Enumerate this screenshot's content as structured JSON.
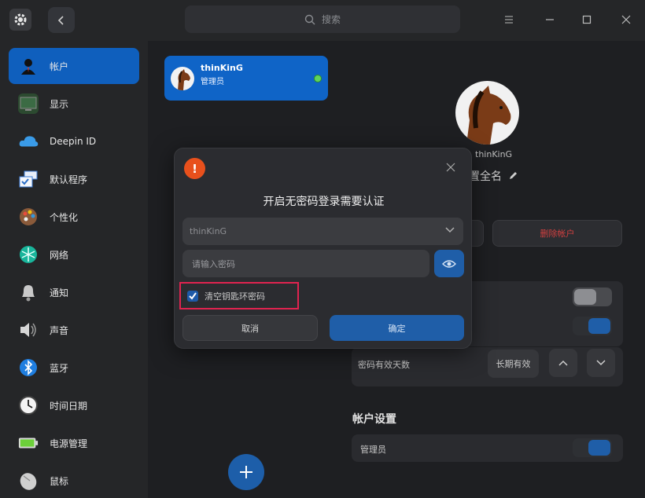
{
  "titlebar": {
    "search_placeholder": "搜索"
  },
  "sidebar": {
    "items": [
      {
        "label": "帐户",
        "icon": "account-icon",
        "active": true
      },
      {
        "label": "显示",
        "icon": "display-icon"
      },
      {
        "label": "Deepin ID",
        "icon": "cloud-icon"
      },
      {
        "label": "默认程序",
        "icon": "default-apps-icon"
      },
      {
        "label": "个性化",
        "icon": "palette-icon"
      },
      {
        "label": "网络",
        "icon": "network-icon"
      },
      {
        "label": "通知",
        "icon": "bell-icon"
      },
      {
        "label": "声音",
        "icon": "speaker-icon"
      },
      {
        "label": "蓝牙",
        "icon": "bluetooth-icon"
      },
      {
        "label": "时间日期",
        "icon": "clock-icon"
      },
      {
        "label": "电源管理",
        "icon": "battery-icon"
      },
      {
        "label": "鼠标",
        "icon": "mouse-icon"
      }
    ]
  },
  "user_card": {
    "name": "thinKinG",
    "role": "管理员"
  },
  "profile": {
    "username": "thinKinG",
    "fullname": "置全名",
    "delete_label": "删除帐户"
  },
  "settings": {
    "validity_label": "密码有效天数",
    "validity_value": "长期有效",
    "account_settings_title": "帐户设置",
    "admin_label": "管理员"
  },
  "dialog": {
    "title": "开启无密码登录需要认证",
    "user_select": "thinKinG",
    "password_placeholder": "请输入密码",
    "checkbox_label": "清空钥匙环密码",
    "checkbox_checked": true,
    "cancel_label": "取消",
    "confirm_label": "确定"
  },
  "colors": {
    "accent": "#0f64c7",
    "danger": "#d24040",
    "warning_icon": "#e8501c",
    "highlight_border": "#e0234f"
  }
}
